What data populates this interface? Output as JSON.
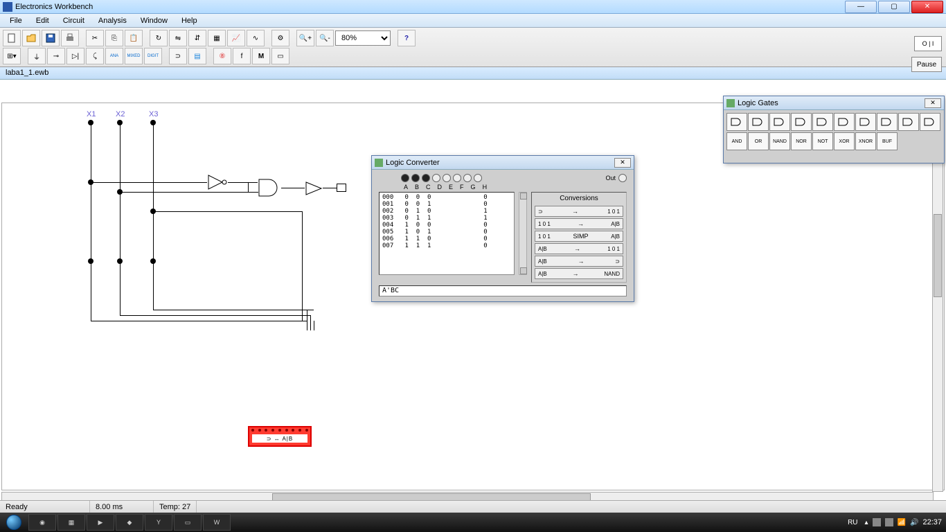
{
  "app": {
    "title": "Electronics Workbench"
  },
  "menu": [
    "File",
    "Edit",
    "Circuit",
    "Analysis",
    "Window",
    "Help"
  ],
  "toolbar": {
    "zoom": "80%",
    "pause": "Pause"
  },
  "doc": {
    "filename": "laba1_1.ewb"
  },
  "circuit": {
    "inputs": [
      "X1",
      "X2",
      "X3"
    ],
    "converter_block_label": "⊃ ↔ A|B"
  },
  "logic_converter": {
    "title": "Logic Converter",
    "out_label": "Out",
    "io_letters": [
      "A",
      "B",
      "C",
      "D",
      "E",
      "F",
      "G",
      "H"
    ],
    "active_inputs": 3,
    "truth_table": [
      {
        "idx": "000",
        "a": 0,
        "b": 0,
        "c": 0,
        "out": 0
      },
      {
        "idx": "001",
        "a": 0,
        "b": 0,
        "c": 1,
        "out": 0
      },
      {
        "idx": "002",
        "a": 0,
        "b": 1,
        "c": 0,
        "out": 1
      },
      {
        "idx": "003",
        "a": 0,
        "b": 1,
        "c": 1,
        "out": 1
      },
      {
        "idx": "004",
        "a": 1,
        "b": 0,
        "c": 0,
        "out": 0
      },
      {
        "idx": "005",
        "a": 1,
        "b": 0,
        "c": 1,
        "out": 0
      },
      {
        "idx": "006",
        "a": 1,
        "b": 1,
        "c": 0,
        "out": 0
      },
      {
        "idx": "007",
        "a": 1,
        "b": 1,
        "c": 1,
        "out": 0
      }
    ],
    "conversions_header": "Conversions",
    "conversions": [
      {
        "from": "⊃",
        "to": "1 0 1"
      },
      {
        "from": "1 0 1",
        "to": "A|B"
      },
      {
        "from": "1 0 1",
        "mid": "SIMP",
        "to": "A|B"
      },
      {
        "from": "A|B",
        "to": "1 0 1"
      },
      {
        "from": "A|B",
        "to": "⊃"
      },
      {
        "from": "A|B",
        "to": "NAND"
      }
    ],
    "expression": "A'BC"
  },
  "logic_gates": {
    "title": "Logic Gates",
    "gates_row1": [
      "AND",
      "OR",
      "NAND",
      "NOR",
      "NOT",
      "XOR",
      "XNOR",
      "BUF",
      "TRI",
      "INV"
    ],
    "gates_row2": [
      "AND",
      "OR",
      "NAND",
      "NOR",
      "NOT",
      "XOR",
      "XNOR",
      "BUF"
    ]
  },
  "status": {
    "ready": "Ready",
    "time": "8.00 ms",
    "temp": "Temp: 27"
  },
  "taskbar": {
    "lang": "RU",
    "clock": "22:37"
  }
}
